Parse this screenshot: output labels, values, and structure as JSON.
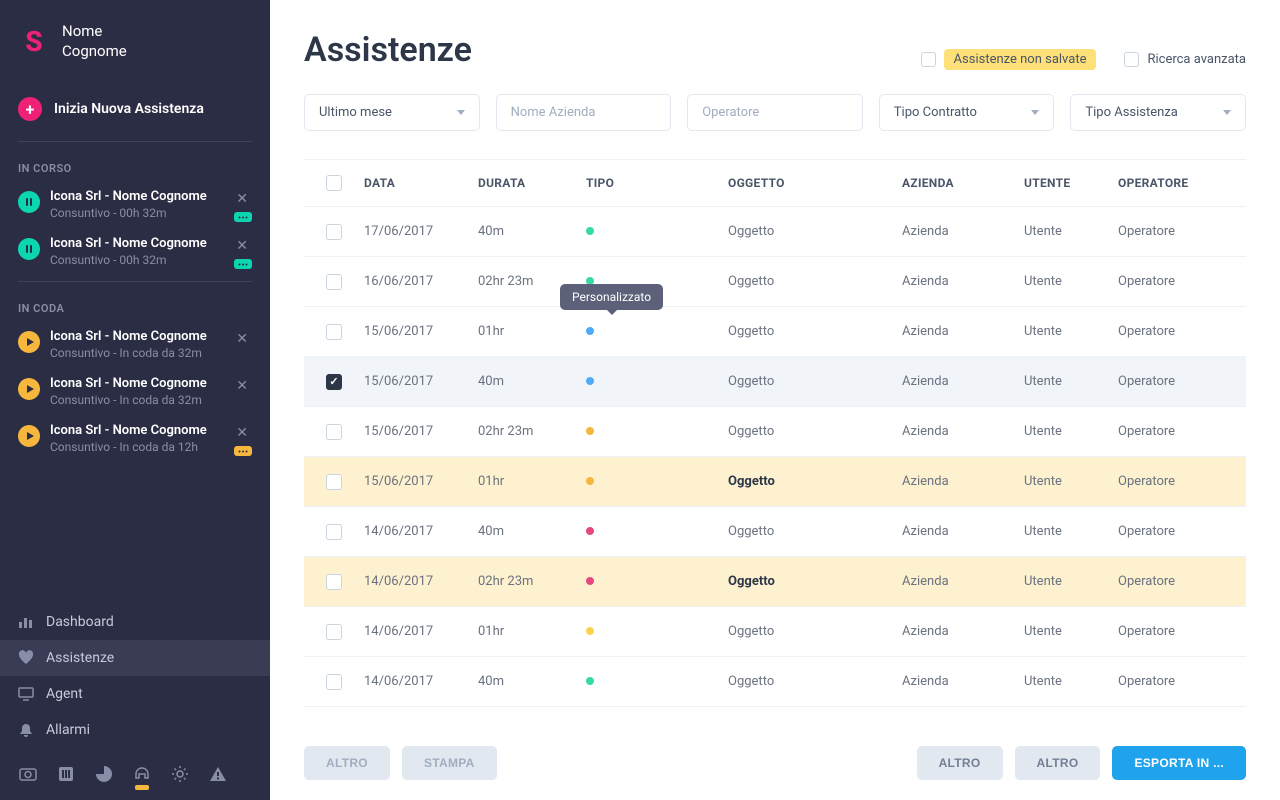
{
  "user": {
    "first": "Nome",
    "last": "Cognome"
  },
  "logo": "S",
  "new_assist_label": "Inizia Nuova Assistenza",
  "sections": {
    "in_corso": "IN CORSO",
    "in_coda": "IN CODA"
  },
  "in_corso": [
    {
      "title": "Icona Srl - Nome Cognome",
      "sub": "Consuntivo - 00h 32m"
    },
    {
      "title": "Icona Srl - Nome Cognome",
      "sub": "Consuntivo - 00h 32m"
    }
  ],
  "in_coda": [
    {
      "title": "Icona Srl - Nome Cognome",
      "sub": "Consuntivo - In coda da 32m"
    },
    {
      "title": "Icona Srl - Nome Cognome",
      "sub": "Consuntivo - In coda da 32m"
    },
    {
      "title": "Icona Srl - Nome Cognome",
      "sub": "Consuntivo - In coda da 12h"
    }
  ],
  "nav": {
    "dashboard": "Dashboard",
    "assistenze": "Assistenze",
    "agent": "Agent",
    "allarmi": "Allarmi"
  },
  "page_title": "Assistenze",
  "header_chk1": "Assistenze non salvate",
  "header_chk2": "Ricerca avanzata",
  "filters": {
    "period": "Ultimo mese",
    "company_ph": "Nome Azienda",
    "operator_ph": "Operatore",
    "contract": "Tipo Contratto",
    "assist_type": "Tipo Assistenza"
  },
  "columns": {
    "data": "DATA",
    "durata": "DURATA",
    "tipo": "TIPO",
    "oggetto": "OGGETTO",
    "azienda": "AZIENDA",
    "utente": "UTENTE",
    "operatore": "OPERATORE"
  },
  "tooltip": "Personalizzato",
  "rows": [
    {
      "data": "17/06/2017",
      "durata": "40m",
      "color": "green",
      "oggetto": "Oggetto",
      "azienda": "Azienda",
      "utente": "Utente",
      "operatore": "Operatore",
      "checked": false,
      "highlight": false,
      "selected": false,
      "bold": false,
      "tooltip": false
    },
    {
      "data": "16/06/2017",
      "durata": "02hr 23m",
      "color": "green",
      "oggetto": "Oggetto",
      "azienda": "Azienda",
      "utente": "Utente",
      "operatore": "Operatore",
      "checked": false,
      "highlight": false,
      "selected": false,
      "bold": false,
      "tooltip": false
    },
    {
      "data": "15/06/2017",
      "durata": "01hr",
      "color": "blue",
      "oggetto": "Oggetto",
      "azienda": "Azienda",
      "utente": "Utente",
      "operatore": "Operatore",
      "checked": false,
      "highlight": false,
      "selected": false,
      "bold": false,
      "tooltip": true
    },
    {
      "data": "15/06/2017",
      "durata": "40m",
      "color": "blue",
      "oggetto": "Oggetto",
      "azienda": "Azienda",
      "utente": "Utente",
      "operatore": "Operatore",
      "checked": true,
      "highlight": false,
      "selected": true,
      "bold": false,
      "tooltip": false
    },
    {
      "data": "15/06/2017",
      "durata": "02hr 23m",
      "color": "orange",
      "oggetto": "Oggetto",
      "azienda": "Azienda",
      "utente": "Utente",
      "operatore": "Operatore",
      "checked": false,
      "highlight": false,
      "selected": false,
      "bold": false,
      "tooltip": false
    },
    {
      "data": "15/06/2017",
      "durata": "01hr",
      "color": "orange",
      "oggetto": "Oggetto",
      "azienda": "Azienda",
      "utente": "Utente",
      "operatore": "Operatore",
      "checked": false,
      "highlight": true,
      "selected": false,
      "bold": true,
      "tooltip": false
    },
    {
      "data": "14/06/2017",
      "durata": "40m",
      "color": "pink",
      "oggetto": "Oggetto",
      "azienda": "Azienda",
      "utente": "Utente",
      "operatore": "Operatore",
      "checked": false,
      "highlight": false,
      "selected": false,
      "bold": false,
      "tooltip": false
    },
    {
      "data": "14/06/2017",
      "durata": "02hr 23m",
      "color": "pink",
      "oggetto": "Oggetto",
      "azienda": "Azienda",
      "utente": "Utente",
      "operatore": "Operatore",
      "checked": false,
      "highlight": true,
      "selected": false,
      "bold": true,
      "tooltip": false
    },
    {
      "data": "14/06/2017",
      "durata": "01hr",
      "color": "yellow",
      "oggetto": "Oggetto",
      "azienda": "Azienda",
      "utente": "Utente",
      "operatore": "Operatore",
      "checked": false,
      "highlight": false,
      "selected": false,
      "bold": false,
      "tooltip": false
    },
    {
      "data": "14/06/2017",
      "durata": "40m",
      "color": "green",
      "oggetto": "Oggetto",
      "azienda": "Azienda",
      "utente": "Utente",
      "operatore": "Operatore",
      "checked": false,
      "highlight": false,
      "selected": false,
      "bold": false,
      "tooltip": false
    }
  ],
  "buttons": {
    "altro": "ALTRO",
    "stampa": "STAMPA",
    "altro2": "ALTRO",
    "altro3": "ALTRO",
    "esporta": "ESPORTA IN ..."
  }
}
